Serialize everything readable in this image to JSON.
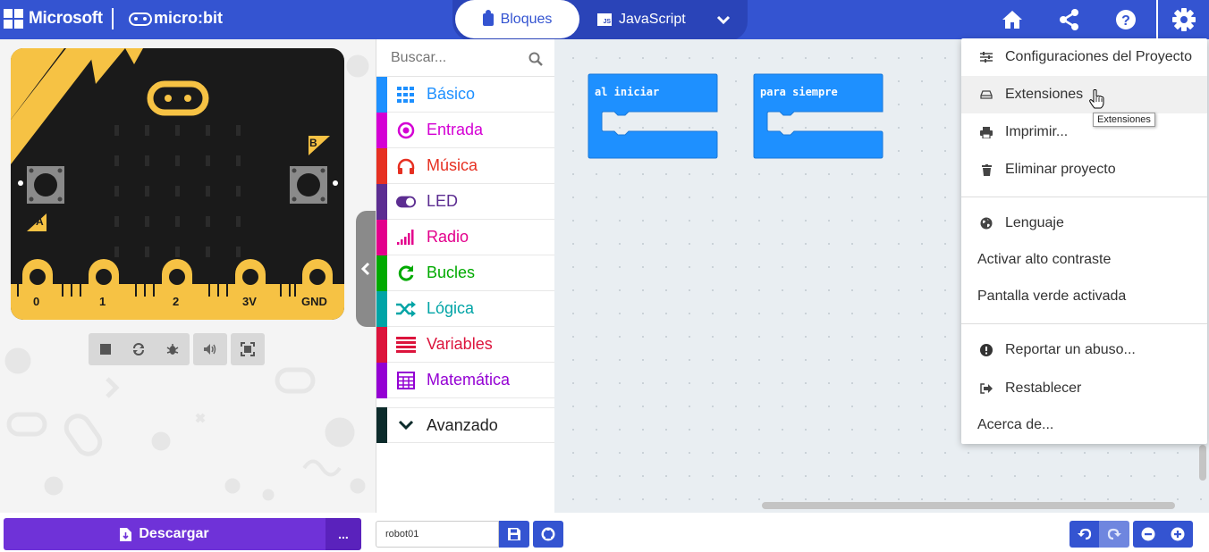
{
  "header": {
    "brand": "Microsoft",
    "product": "micro:bit",
    "tabs": [
      {
        "label": "Bloques",
        "active": true
      },
      {
        "label": "JavaScript",
        "active": false
      }
    ],
    "icons": [
      "home-icon",
      "share-icon",
      "help-icon",
      "settings-icon"
    ],
    "color": "#3454d1"
  },
  "simulator": {
    "pins": [
      "0",
      "1",
      "2",
      "3V",
      "GND"
    ],
    "button_a": "A",
    "button_b": "B",
    "controls": [
      "stop-icon",
      "restart-icon",
      "debug-icon",
      "sound-icon",
      "fullscreen-icon"
    ]
  },
  "toolbox": {
    "search_placeholder": "Buscar...",
    "categories": [
      {
        "label": "Básico",
        "color": "#1e90ff",
        "icon": "grid-icon"
      },
      {
        "label": "Entrada",
        "color": "#d400d4",
        "icon": "target-icon"
      },
      {
        "label": "Música",
        "color": "#e63022",
        "icon": "headphones-icon"
      },
      {
        "label": "LED",
        "color": "#5c2d91",
        "icon": "toggle-icon"
      },
      {
        "label": "Radio",
        "color": "#e3008c",
        "icon": "signal-bars-icon"
      },
      {
        "label": "Bucles",
        "color": "#00aa00",
        "icon": "refresh-icon"
      },
      {
        "label": "Lógica",
        "color": "#00a4a6",
        "icon": "shuffle-icon"
      },
      {
        "label": "Variables",
        "color": "#dc143c",
        "icon": "lines-icon"
      },
      {
        "label": "Matemática",
        "color": "#9400d3",
        "icon": "calculator-icon"
      },
      {
        "label": "Avanzado",
        "color": "#0c2b2b",
        "icon": "chevron-down-icon"
      }
    ]
  },
  "workspace": {
    "blocks": [
      {
        "label": "al iniciar",
        "color": "#1e90ff"
      },
      {
        "label": "para siempre",
        "color": "#1e90ff"
      }
    ]
  },
  "settings_menu": {
    "items": [
      {
        "label": "Configuraciones del Proyecto",
        "icon": "sliders-icon"
      },
      {
        "label": "Extensiones",
        "icon": "drive-icon",
        "hovered": true
      },
      {
        "label": "Imprimir...",
        "icon": "printer-icon"
      },
      {
        "label": "Eliminar proyecto",
        "icon": "trash-icon"
      },
      {
        "label": "Lenguaje",
        "icon": "globe-icon"
      },
      {
        "label": "Activar alto contraste",
        "icon": ""
      },
      {
        "label": "Pantalla verde activada",
        "icon": ""
      },
      {
        "label": "Reportar un abuso...",
        "icon": "alert-icon"
      },
      {
        "label": "Restablecer",
        "icon": "sign-out-icon"
      },
      {
        "label": "Acerca de...",
        "icon": ""
      }
    ],
    "tooltip": "Extensiones"
  },
  "bottom_bar": {
    "download_label": "Descargar",
    "more_label": "...",
    "project_name": "robot01",
    "download_color": "#6f32d8"
  }
}
